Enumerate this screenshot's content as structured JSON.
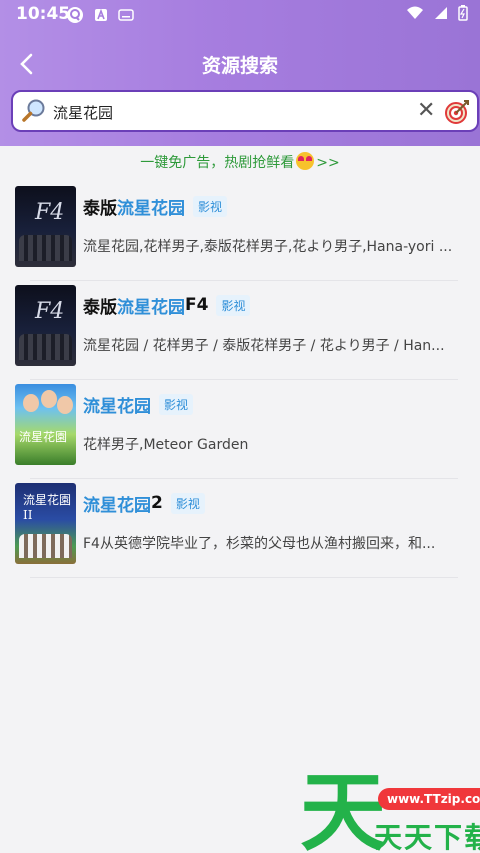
{
  "status_bar": {
    "time": "10:45"
  },
  "header": {
    "title": "资源搜索"
  },
  "search": {
    "value": "流星花园",
    "placeholder": ""
  },
  "promo": {
    "text": "一键免广告，热剧抢鲜看",
    "suffix": ">>"
  },
  "results": [
    {
      "prefix": "泰版",
      "highlight": "流星花园",
      "suffix": "",
      "tag": "影视",
      "desc": "流星花园,花样男子,泰版花样男子,花より男子,Hana-yori ..."
    },
    {
      "prefix": "泰版",
      "highlight": "流星花园",
      "suffix": " F4",
      "tag": "影视",
      "desc": "流星花园 / 花样男子 / 泰版花样男子 / 花より男子 / Han..."
    },
    {
      "prefix": "",
      "highlight": "流星花园",
      "suffix": "",
      "tag": "影视",
      "desc": "花样男子,Meteor Garden"
    },
    {
      "prefix": "",
      "highlight": "流星花园",
      "suffix": "2",
      "tag": "影视",
      "desc": "F4从英德学院毕业了，杉菜的父母也从渔村搬回来，和..."
    }
  ],
  "watermark": {
    "big_char": "天",
    "url": "www.TTzip.com",
    "text": "天天下载"
  },
  "colors": {
    "header": "#a67ddf",
    "highlight": "#2f8fd8",
    "promo": "#2e9a3a"
  }
}
